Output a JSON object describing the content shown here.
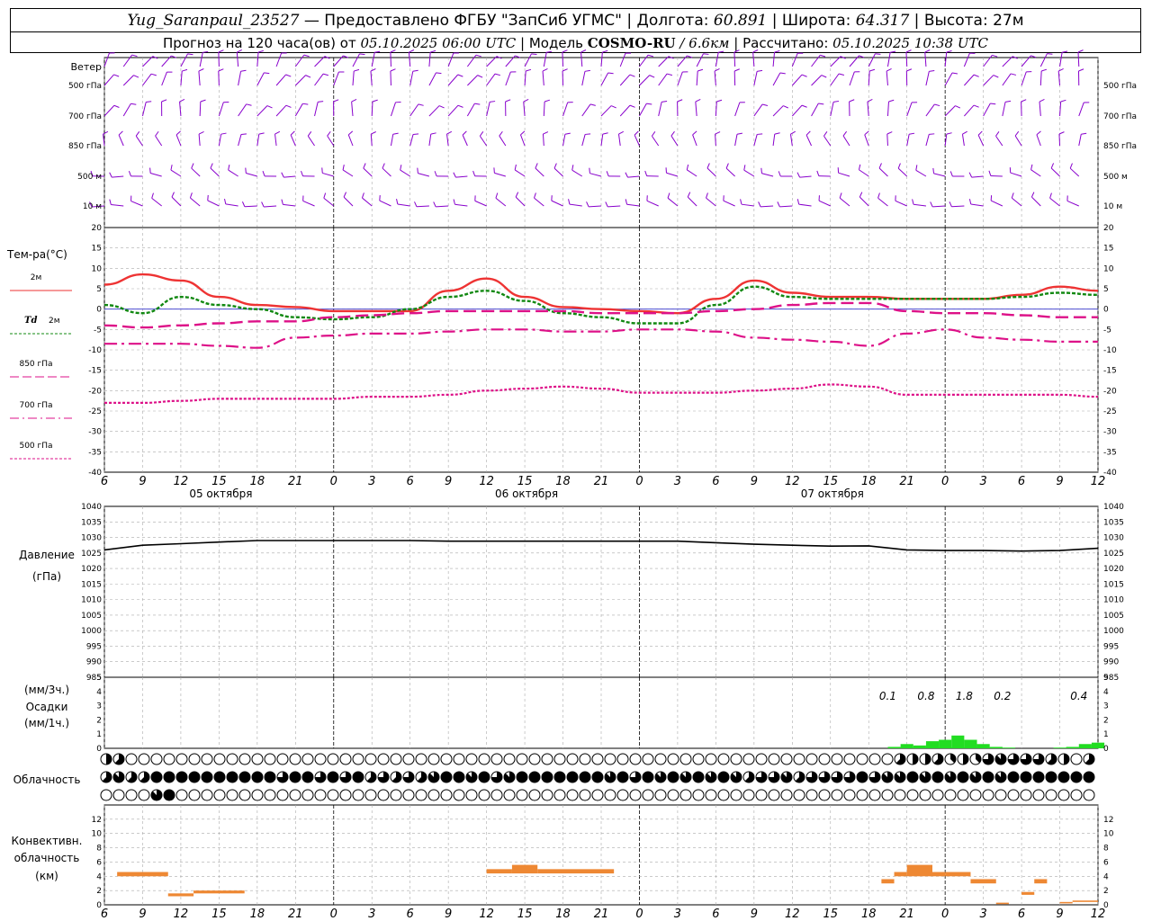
{
  "header": {
    "station": "Yug_Saranpaul_23527",
    "dash": "—",
    "provider": "Предоставлено ФГБУ \"ЗапСиб УГМС\"",
    "lon_label": "Долгота:",
    "lon_value": "60.891",
    "lat_label": "Широта:",
    "lat_value": "64.317",
    "alt_label": "Высота:",
    "alt_value": "27м",
    "forecast_label": "Прогноз на 120 часа(ов) от",
    "forecast_time": "05.10.2025 06:00 UTC",
    "model_label": "Модель",
    "model_name": "COSMO-RU",
    "model_res": "/ 6.6км",
    "computed_label": "Рассчитано:",
    "computed_time": "05.10.2025 10:38 UTC"
  },
  "colors": {
    "wind": "#8800cc",
    "t2m": "#ee3333",
    "td2m": "#118811",
    "t850": "#dd1188",
    "t700": "#dd1188",
    "t500": "#dd1188",
    "pressure": "#000000",
    "precip": "#22dd22",
    "convective": "#ee8833"
  },
  "time_axis": {
    "tick_labels": [
      "6",
      "9",
      "12",
      "15",
      "18",
      "21",
      "0",
      "3",
      "6",
      "9",
      "12",
      "15",
      "18",
      "21",
      "0",
      "3",
      "6",
      "9",
      "12",
      "15",
      "18",
      "21",
      "0",
      "3",
      "6",
      "9",
      "12"
    ],
    "day_labels": [
      "05 октября",
      "06 октября",
      "07 октября"
    ]
  },
  "chart_data": [
    {
      "type": "wind_barbs",
      "title": "Ветер",
      "levels": [
        "500 гПа",
        "700 гПа",
        "850 гПа",
        "500 м",
        "10 м"
      ]
    },
    {
      "type": "line",
      "ylabel": "Тем-ра(°C)",
      "ylim": [
        -40,
        20
      ],
      "yticks": [
        20,
        15,
        10,
        5,
        0,
        -5,
        -10,
        -15,
        -20,
        -25,
        -30,
        -35,
        -40
      ],
      "x_hours": [
        0,
        3,
        6,
        9,
        12,
        15,
        18,
        21,
        24,
        27,
        30,
        33,
        36,
        39,
        42,
        45,
        48,
        51,
        54,
        57,
        60,
        63,
        66,
        69,
        72,
        75,
        78
      ],
      "series": [
        {
          "name": "2м",
          "values": [
            6,
            8.5,
            7,
            3,
            1,
            0.5,
            -0.5,
            -0.5,
            -0.5,
            4.5,
            7.5,
            3,
            0.5,
            0,
            -0.5,
            -1,
            2.5,
            7,
            4,
            3,
            3,
            2.5,
            2.5,
            2.5,
            3.5,
            5.5,
            4.5
          ]
        },
        {
          "name": "Td 2м",
          "values": [
            1,
            -1,
            3,
            1,
            0,
            -2,
            -2.5,
            -2,
            0,
            3,
            4.5,
            2,
            -1,
            -2,
            -3.5,
            -3.5,
            1,
            5.5,
            3,
            2.5,
            2.5,
            2.5,
            2.5,
            2.5,
            3,
            4,
            3.5
          ]
        },
        {
          "name": "850 гПа",
          "values": [
            -4,
            -4.5,
            -4,
            -3.5,
            -3,
            -3,
            -2,
            -1.5,
            -1,
            -0.5,
            -0.5,
            -0.5,
            -0.5,
            -1,
            -1,
            -1,
            -0.5,
            0,
            1,
            1.5,
            1.5,
            -0.5,
            -1,
            -1,
            -1.5,
            -2,
            -2
          ]
        },
        {
          "name": "700 гПа",
          "values": [
            -8.5,
            -8.5,
            -8.5,
            -9,
            -9.5,
            -7,
            -6.5,
            -6,
            -6,
            -5.5,
            -5,
            -5,
            -5.5,
            -5.5,
            -5,
            -5,
            -5.5,
            -7,
            -7.5,
            -8,
            -9,
            -6,
            -5,
            -7,
            -7.5,
            -8,
            -8
          ]
        },
        {
          "name": "500 гПа",
          "values": [
            -23,
            -23,
            -22.5,
            -22,
            -22,
            -22,
            -22,
            -21.5,
            -21.5,
            -21,
            -20,
            -19.5,
            -19,
            -19.5,
            -20.5,
            -20.5,
            -20.5,
            -20,
            -19.5,
            -18.5,
            -19,
            -21,
            -21,
            -21,
            -21,
            -21,
            -21.5
          ]
        }
      ]
    },
    {
      "type": "line",
      "ylabel": "Давление",
      "yunit": "(гПа)",
      "ylim": [
        985,
        1040
      ],
      "yticks": [
        1040,
        1035,
        1030,
        1025,
        1020,
        1015,
        1010,
        1005,
        1000,
        995,
        990,
        985
      ],
      "x_hours": [
        0,
        3,
        6,
        9,
        12,
        15,
        18,
        21,
        24,
        27,
        30,
        33,
        36,
        39,
        42,
        45,
        48,
        51,
        54,
        57,
        60,
        63,
        66,
        69,
        72,
        75,
        78
      ],
      "series": [
        {
          "name": "Давление",
          "values": [
            1026,
            1027.5,
            1028,
            1028.5,
            1029,
            1029,
            1029,
            1029,
            1029,
            1028.8,
            1028.8,
            1028.8,
            1028.8,
            1028.8,
            1028.8,
            1028.8,
            1028.3,
            1027.8,
            1027.5,
            1027.2,
            1027.3,
            1026,
            1025.8,
            1025.8,
            1025.6,
            1025.8,
            1026.5
          ]
        }
      ]
    },
    {
      "type": "bar",
      "ylabel_top": "(мм/3ч.)",
      "ylabel": "Осадки",
      "ylabel_bottom": "(мм/1ч.)",
      "ylim": [
        0,
        5
      ],
      "yticks": [
        5,
        4,
        3,
        2,
        1,
        0
      ],
      "bars_x_hours": [
        62,
        63,
        64,
        65,
        66,
        67,
        68,
        69,
        70,
        71,
        72,
        73,
        74,
        75,
        76,
        77,
        78
      ],
      "values": [
        0.1,
        0.3,
        0.2,
        0.5,
        0.6,
        0.9,
        0.6,
        0.3,
        0.1,
        0.05,
        0,
        0,
        0,
        0.05,
        0.1,
        0.3,
        0.4
      ],
      "annotations": [
        {
          "x_hour": 61.5,
          "text": "0.1"
        },
        {
          "x_hour": 64.5,
          "text": "0.8"
        },
        {
          "x_hour": 67.5,
          "text": "1.8"
        },
        {
          "x_hour": 70.5,
          "text": "0.2"
        },
        {
          "x_hour": 76.5,
          "text": "0.4"
        }
      ]
    },
    {
      "type": "cloud_cover",
      "ylabel": "Облачность",
      "rows": [
        {
          "layer": "upper",
          "values": "45000000000000000000000000000000000000000000000000000000000000054453436766654050000000000000000000000000000008876878888888888888888885666666667777777777767653000000"
        },
        {
          "layer": "middle",
          "values": "57558888888888688686856565788786788888887868787878756675666686778787878788888888878787877886867888883000500500600000000000000000000000008888888888888888888888888888888"
        },
        {
          "layer": "lower",
          "values": "00007800000000000000000000000000000000000000000000000000000000000000000000000000000000000000000000000000000000000000000000000000000000000000000000000000000000000000000000000084440088888888"
        }
      ]
    },
    {
      "type": "bar",
      "ylabel": "Конвективн. облачность",
      "yunit": "(км)",
      "ylim": [
        0,
        14
      ],
      "yticks": [
        12,
        10,
        8,
        6,
        4,
        2,
        0
      ],
      "segments": [
        {
          "x0": 1,
          "x1": 5,
          "bottom": 4,
          "top": 4.6
        },
        {
          "x0": 5,
          "x1": 7,
          "bottom": 1.2,
          "top": 1.6
        },
        {
          "x0": 7,
          "x1": 11,
          "bottom": 1.6,
          "top": 2
        },
        {
          "x0": 30,
          "x1": 32,
          "bottom": 4.4,
          "top": 5
        },
        {
          "x0": 32,
          "x1": 34,
          "bottom": 4.4,
          "top": 5.6
        },
        {
          "x0": 34,
          "x1": 40,
          "bottom": 4.4,
          "top": 5
        },
        {
          "x0": 61,
          "x1": 62,
          "bottom": 3,
          "top": 3.6
        },
        {
          "x0": 62,
          "x1": 63,
          "bottom": 4,
          "top": 4.6
        },
        {
          "x0": 63,
          "x1": 65,
          "bottom": 4,
          "top": 5.6
        },
        {
          "x0": 65,
          "x1": 66,
          "bottom": 4,
          "top": 4.6
        },
        {
          "x0": 66,
          "x1": 68,
          "bottom": 4,
          "top": 4.6
        },
        {
          "x0": 68,
          "x1": 70,
          "bottom": 3,
          "top": 3.6
        },
        {
          "x0": 70,
          "x1": 71,
          "bottom": 0.1,
          "top": 0.3
        },
        {
          "x0": 72,
          "x1": 73,
          "bottom": 1.4,
          "top": 1.8
        },
        {
          "x0": 73,
          "x1": 74,
          "bottom": 3,
          "top": 3.6
        },
        {
          "x0": 75,
          "x1": 76,
          "bottom": 0.2,
          "top": 0.4
        },
        {
          "x0": 76,
          "x1": 78,
          "bottom": 0.4,
          "top": 0.6
        }
      ]
    }
  ],
  "legend": {
    "t2m": "2м",
    "td_symbol": "Td",
    "td_label": "2м",
    "t850": "850 гПа",
    "t700": "700 гПа",
    "t500": "500 гПа"
  }
}
